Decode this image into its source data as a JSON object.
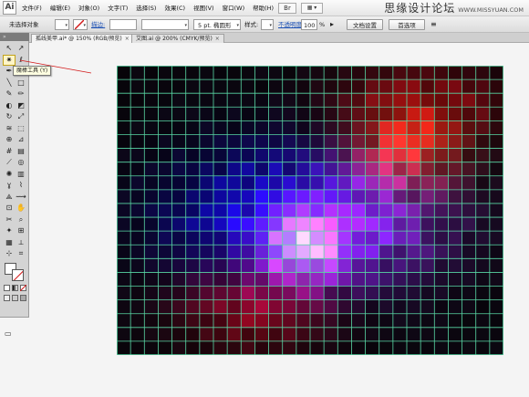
{
  "app": {
    "logo": "Ai"
  },
  "menu": [
    "文件(F)",
    "编辑(E)",
    "对象(O)",
    "文字(T)",
    "选择(S)",
    "效果(C)",
    "视图(V)",
    "窗口(W)",
    "帮助(H)"
  ],
  "menu_extra": {
    "bridge": "Br",
    "arrange": "▦ ▾"
  },
  "watermark": {
    "site_cn": "思缘设计论坛",
    "site_url": "WWW.MISSYUAN.COM"
  },
  "control_bar": {
    "selection_label": "未选择对象",
    "stroke_label": "描边:",
    "stroke_weight": "",
    "brush_label": "5 pt. 椭圆形",
    "style_label": "样式:",
    "opacity_label": "不透明度",
    "opacity_value": "100",
    "opacity_unit": "%",
    "doc_setup_button": "文档设置",
    "prefs_button": "首选项"
  },
  "tabs": [
    {
      "label": "孤线美甲.ai* @ 150% (RGB/预览)",
      "close": "×"
    },
    {
      "label": "艾图.ai @ 200% (CMYK/预览)",
      "close": "×"
    }
  ],
  "tools_panel": {
    "header": "» ",
    "tools": [
      {
        "name": "selection-tool-icon",
        "glyph": "↖"
      },
      {
        "name": "direct-selection-tool-icon",
        "glyph": "↗"
      },
      {
        "name": "magic-wand-tool-icon",
        "glyph": "✷"
      },
      {
        "name": "lasso-tool-icon",
        "glyph": "ℓ"
      },
      {
        "name": "pen-tool-icon",
        "glyph": "✒"
      },
      {
        "name": "type-tool-icon",
        "glyph": "T"
      },
      {
        "name": "line-tool-icon",
        "glyph": "╲"
      },
      {
        "name": "rectangle-tool-icon",
        "glyph": "□"
      },
      {
        "name": "paintbrush-tool-icon",
        "glyph": "✎"
      },
      {
        "name": "pencil-tool-icon",
        "glyph": "✏"
      },
      {
        "name": "blob-brush-tool-icon",
        "glyph": "◐"
      },
      {
        "name": "eraser-tool-icon",
        "glyph": "◩"
      },
      {
        "name": "rotate-tool-icon",
        "glyph": "↻"
      },
      {
        "name": "scale-tool-icon",
        "glyph": "⤢"
      },
      {
        "name": "warp-tool-icon",
        "glyph": "≋"
      },
      {
        "name": "free-transform-tool-icon",
        "glyph": "⬚"
      },
      {
        "name": "shape-builder-tool-icon",
        "glyph": "⊕"
      },
      {
        "name": "perspective-grid-tool-icon",
        "glyph": "⊿"
      },
      {
        "name": "mesh-tool-icon",
        "glyph": "#"
      },
      {
        "name": "gradient-tool-icon",
        "glyph": "▤"
      },
      {
        "name": "eyedropper-tool-icon",
        "glyph": "⟋"
      },
      {
        "name": "blend-tool-icon",
        "glyph": "◎"
      },
      {
        "name": "symbol-sprayer-tool-icon",
        "glyph": "✺"
      },
      {
        "name": "column-graph-tool-icon",
        "glyph": "▥"
      },
      {
        "name": "live-paint-tool-icon",
        "glyph": "ɣ"
      },
      {
        "name": "live-paint-selection-tool-icon",
        "glyph": "⌇"
      },
      {
        "name": "slice-tool-icon",
        "glyph": "⟁"
      },
      {
        "name": "width-tool-icon",
        "glyph": "⟿"
      },
      {
        "name": "artboard-tool-icon",
        "glyph": "⊡"
      },
      {
        "name": "hand-tool-icon",
        "glyph": "✋"
      },
      {
        "name": "scissors-tool-icon",
        "glyph": "✂"
      },
      {
        "name": "zoom-tool-icon",
        "glyph": "⌕"
      },
      {
        "name": "symbol-tool-icon",
        "glyph": "✦"
      },
      {
        "name": "graph-tool-icon",
        "glyph": "⊞"
      },
      {
        "name": "chart-tool-icon",
        "glyph": "▦"
      },
      {
        "name": "knife-tool-icon",
        "glyph": "⟂"
      },
      {
        "name": "measure-tool-icon",
        "glyph": "⊹"
      },
      {
        "name": "crop-tool-icon",
        "glyph": "⌗"
      }
    ]
  },
  "tooltip": {
    "text": "魔棒工具 (Y)"
  },
  "colors": {
    "grid_line": "#59d7a4",
    "annotation_red": "#d21a1a",
    "tooltip_bg": "#ffffe1"
  },
  "artwork": {
    "cols": 28,
    "rows": 21,
    "description_colors": {
      "background": "#08060c"
    }
  }
}
